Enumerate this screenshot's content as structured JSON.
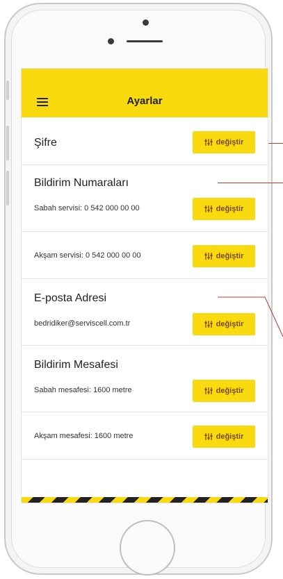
{
  "app": {
    "title": "Ayarlar"
  },
  "change_label": "değiştir",
  "password": {
    "label": "Şifre"
  },
  "notification_numbers": {
    "heading": "Bildirim Numaraları",
    "morning": "Sabah servisi: 0 542 000 00 00",
    "evening": "Akşam servisi: 0 542 000 00 00"
  },
  "email": {
    "heading": "E-posta Adresi",
    "value": "bedridiker@serviscell.com.tr"
  },
  "notification_distance": {
    "heading": "Bildirim Mesafesi",
    "morning": "Sabah mesafesi: 1600 metre",
    "evening": "Akşam mesafesi: 1600 metre"
  },
  "colors": {
    "accent": "#f8da0f",
    "annotation": "#c0392b"
  }
}
